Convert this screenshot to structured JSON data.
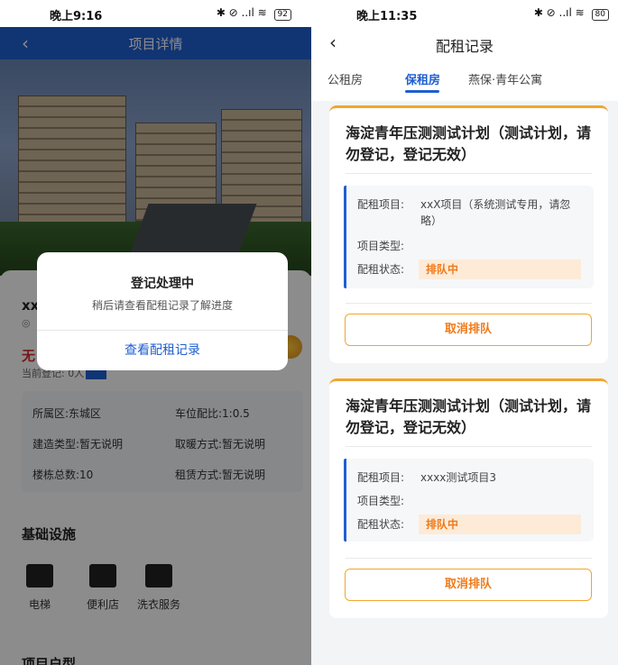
{
  "left": {
    "status_time": "晚上9:16",
    "status_icons": "✱ ⊘ ..ıl ≋",
    "battery": "92",
    "header_title": "项目详情",
    "project_name": "xx",
    "price_text": "无",
    "register_count": "当前登记: 0人",
    "info_cells": [
      {
        "text": "所属区:东城区"
      },
      {
        "text": "车位配比:1:0.5"
      },
      {
        "text": "建造类型:暂无说明"
      },
      {
        "text": "取暖方式:暂无说明"
      },
      {
        "text": "楼栋总数:10"
      },
      {
        "text": "租赁方式:暂无说明"
      }
    ],
    "facilities_title": "基础设施",
    "facilities": [
      {
        "label": "电梯"
      },
      {
        "label": "便利店"
      },
      {
        "label": "洗衣服务"
      }
    ],
    "floorplan_title": "项目户型",
    "dialog": {
      "title": "登记处理中",
      "message": "稍后请查看配租记录了解进度",
      "button": "查看配租记录"
    }
  },
  "right": {
    "status_time": "晚上11:35",
    "status_icons": "✱ ⊘ ..ıl ≋",
    "battery": "80",
    "page_title": "配租记录",
    "tabs": [
      {
        "label": "公租房"
      },
      {
        "label": "保租房"
      },
      {
        "label": "燕保·青年公寓"
      }
    ],
    "cards": [
      {
        "title": "海淀青年压测测试计划（测试计划，请勿登记，登记无效）",
        "label_project": "配租项目:",
        "project": "xxX项目（系统测试专用，请忽略）",
        "label_type": "项目类型:",
        "type": "",
        "label_status": "配租状态:",
        "status": "排队中",
        "button": "取消排队"
      },
      {
        "title": "海淀青年压测测试计划（测试计划，请勿登记，登记无效）",
        "label_project": "配租项目:",
        "project": "xxxx测试项目3",
        "label_type": "项目类型:",
        "type": "",
        "label_status": "配租状态:",
        "status": "排队中",
        "button": "取消排队"
      }
    ]
  },
  "colors": {
    "primary_blue": "#1f5fd1",
    "accent_orange": "#f2a52f",
    "status_orange": "#f07a1a",
    "price_red": "#d92b2b"
  }
}
